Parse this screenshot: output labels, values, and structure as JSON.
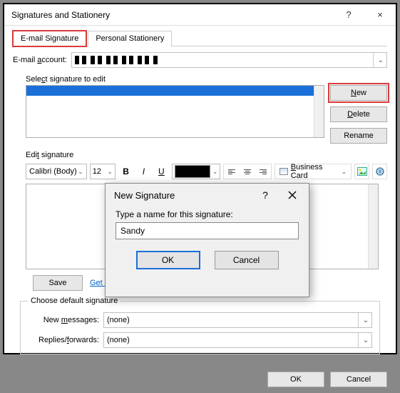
{
  "window": {
    "title": "Signatures and Stationery",
    "help": "?",
    "close": "×"
  },
  "tabs": {
    "email": "E-mail Signature",
    "stationery": "Personal Stationery"
  },
  "account": {
    "label": "E-mail account:",
    "value": "••••@••••••.•••"
  },
  "select_sig": {
    "label": "Select signature to edit",
    "new": "New",
    "delete": "Delete",
    "rename": "Rename"
  },
  "edit_sig": {
    "label": "Edit signature",
    "font": "Calibri (Body)",
    "size": "12",
    "bizcard": "Business Card",
    "save": "Save",
    "get_templates": "Get signature templates"
  },
  "defaults": {
    "legend": "Choose default signature",
    "new_msg_label": "New messages:",
    "new_msg_val": "(none)",
    "reply_label": "Replies/forwards:",
    "reply_val": "(none)"
  },
  "footer": {
    "ok": "OK",
    "cancel": "Cancel"
  },
  "modal": {
    "title": "New Signature",
    "help": "?",
    "close": "×",
    "prompt": "Type a name for this signature:",
    "value": "Sandy",
    "ok": "OK",
    "cancel": "Cancel"
  }
}
